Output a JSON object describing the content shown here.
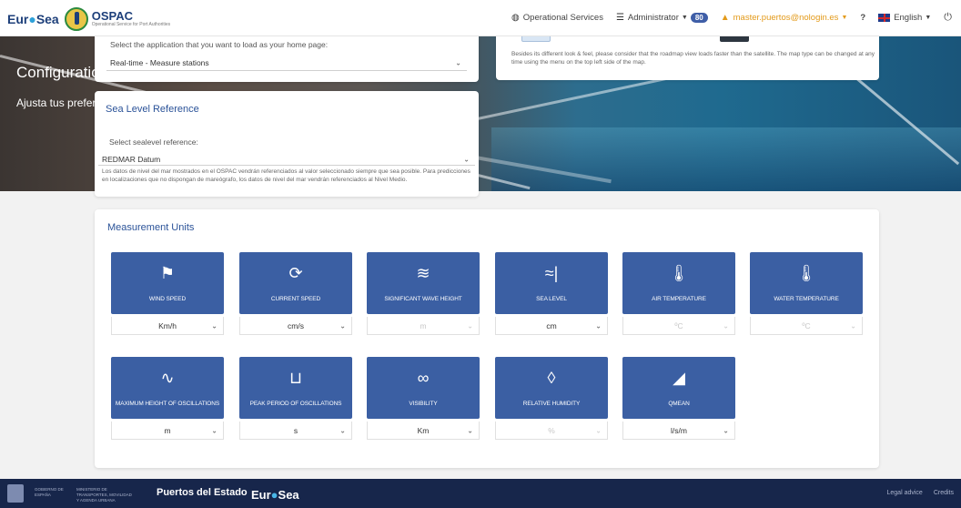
{
  "brand": {
    "eure_prefix": "Eur",
    "eure_o": "●",
    "eure_suffix": "Sea",
    "ospac_title": "OSPAC",
    "ospac_sub": "Operational Service for Port Authorities"
  },
  "navbar": {
    "operational_services": "Operational Services",
    "administrator": "Administrator",
    "admin_badge": "80",
    "user": "master.puertos@nologin.es",
    "help": "?",
    "language": "English",
    "power_icon": "power-icon"
  },
  "hero": {
    "title": "Configuration",
    "subtitle": "Ajusta tus preferencias"
  },
  "app_panel": {
    "label": "Select the application that you want to load as your home page:",
    "selected": "Real-time - Measure stations"
  },
  "map_panel": {
    "note": "Besides its different look & feel, please consider that the roadmap view loads faster than the satellite. The map type can be changed at any time using the menu on the top left side of the map."
  },
  "sea_level": {
    "title": "Sea Level Reference",
    "label": "Select sealevel reference:",
    "selected": "REDMAR Datum",
    "note": "Los datos de nivel del mar mostrados en el OSPAC vendrán referenciados al valor seleccionado siempre que sea posible. Para predicciones en localizaciones que no dispongan de mareógrafo, los datos de nivel del mar vendrán referenciados al Nivel Medio."
  },
  "units": {
    "title": "Measurement Units",
    "tiles": [
      {
        "label": "WIND SPEED",
        "icon": "wind-sock-icon",
        "glyph": "⚑",
        "value": "Km/h",
        "disabled": false
      },
      {
        "label": "CURRENT SPEED",
        "icon": "current-cycle-icon",
        "glyph": "⟳",
        "value": "cm/s",
        "disabled": false
      },
      {
        "label": "SIGNIFICANT WAVE HEIGHT",
        "icon": "waves-icon",
        "glyph": "≋",
        "value": "m",
        "disabled": true
      },
      {
        "label": "SEA LEVEL",
        "icon": "sea-level-icon",
        "glyph": "≈|",
        "value": "cm",
        "disabled": false
      },
      {
        "label": "AIR TEMPERATURE",
        "icon": "air-temperature-icon",
        "glyph": "🌡",
        "value": "ºC",
        "disabled": true
      },
      {
        "label": "WATER TEMPERATURE",
        "icon": "water-temperature-icon",
        "glyph": "🌡",
        "value": "ºC",
        "disabled": true
      },
      {
        "label": "MAXIMUM HEIGHT OF OSCILLATIONS",
        "icon": "oscillation-height-icon",
        "glyph": "∿",
        "value": "m",
        "disabled": false
      },
      {
        "label": "PEAK PERIOD OF OSCILLATIONS",
        "icon": "peak-period-icon",
        "glyph": "⊔",
        "value": "s",
        "disabled": false
      },
      {
        "label": "VISIBILITY",
        "icon": "binoculars-icon",
        "glyph": "∞",
        "value": "Km",
        "disabled": false
      },
      {
        "label": "RELATIVE HUMIDITY",
        "icon": "humidity-icon",
        "glyph": "◊",
        "value": "%",
        "disabled": true
      },
      {
        "label": "QMEAN",
        "icon": "qmean-icon",
        "glyph": "◢",
        "value": "l/s/m",
        "disabled": false
      }
    ]
  },
  "footer": {
    "gov_text": "GOBIERNO DE ESPAÑA",
    "ministry_text": "MINISTERIO DE TRANSPORTES, MOVILIDAD Y AGENDA URBANA",
    "puertos": "Puertos del Estado",
    "eure_prefix": "Eur",
    "eure_o": "●",
    "eure_suffix": "Sea",
    "legal": "Legal advice",
    "credits": "Credits"
  }
}
